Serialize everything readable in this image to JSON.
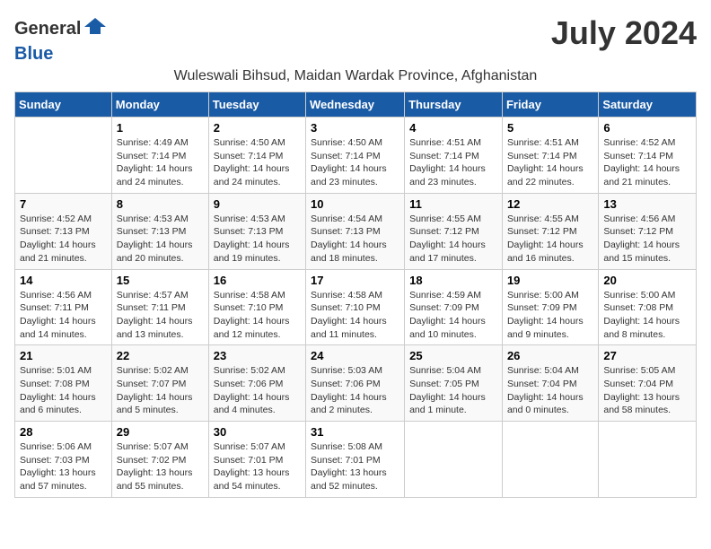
{
  "header": {
    "logo_general": "General",
    "logo_blue": "Blue",
    "month_title": "July 2024",
    "subtitle": "Wuleswali Bihsud, Maidan Wardak Province, Afghanistan"
  },
  "days_of_week": [
    "Sunday",
    "Monday",
    "Tuesday",
    "Wednesday",
    "Thursday",
    "Friday",
    "Saturday"
  ],
  "weeks": [
    [
      {
        "day": "",
        "info": ""
      },
      {
        "day": "1",
        "info": "Sunrise: 4:49 AM\nSunset: 7:14 PM\nDaylight: 14 hours\nand 24 minutes."
      },
      {
        "day": "2",
        "info": "Sunrise: 4:50 AM\nSunset: 7:14 PM\nDaylight: 14 hours\nand 24 minutes."
      },
      {
        "day": "3",
        "info": "Sunrise: 4:50 AM\nSunset: 7:14 PM\nDaylight: 14 hours\nand 23 minutes."
      },
      {
        "day": "4",
        "info": "Sunrise: 4:51 AM\nSunset: 7:14 PM\nDaylight: 14 hours\nand 23 minutes."
      },
      {
        "day": "5",
        "info": "Sunrise: 4:51 AM\nSunset: 7:14 PM\nDaylight: 14 hours\nand 22 minutes."
      },
      {
        "day": "6",
        "info": "Sunrise: 4:52 AM\nSunset: 7:14 PM\nDaylight: 14 hours\nand 21 minutes."
      }
    ],
    [
      {
        "day": "7",
        "info": "Sunrise: 4:52 AM\nSunset: 7:13 PM\nDaylight: 14 hours\nand 21 minutes."
      },
      {
        "day": "8",
        "info": "Sunrise: 4:53 AM\nSunset: 7:13 PM\nDaylight: 14 hours\nand 20 minutes."
      },
      {
        "day": "9",
        "info": "Sunrise: 4:53 AM\nSunset: 7:13 PM\nDaylight: 14 hours\nand 19 minutes."
      },
      {
        "day": "10",
        "info": "Sunrise: 4:54 AM\nSunset: 7:13 PM\nDaylight: 14 hours\nand 18 minutes."
      },
      {
        "day": "11",
        "info": "Sunrise: 4:55 AM\nSunset: 7:12 PM\nDaylight: 14 hours\nand 17 minutes."
      },
      {
        "day": "12",
        "info": "Sunrise: 4:55 AM\nSunset: 7:12 PM\nDaylight: 14 hours\nand 16 minutes."
      },
      {
        "day": "13",
        "info": "Sunrise: 4:56 AM\nSunset: 7:12 PM\nDaylight: 14 hours\nand 15 minutes."
      }
    ],
    [
      {
        "day": "14",
        "info": "Sunrise: 4:56 AM\nSunset: 7:11 PM\nDaylight: 14 hours\nand 14 minutes."
      },
      {
        "day": "15",
        "info": "Sunrise: 4:57 AM\nSunset: 7:11 PM\nDaylight: 14 hours\nand 13 minutes."
      },
      {
        "day": "16",
        "info": "Sunrise: 4:58 AM\nSunset: 7:10 PM\nDaylight: 14 hours\nand 12 minutes."
      },
      {
        "day": "17",
        "info": "Sunrise: 4:58 AM\nSunset: 7:10 PM\nDaylight: 14 hours\nand 11 minutes."
      },
      {
        "day": "18",
        "info": "Sunrise: 4:59 AM\nSunset: 7:09 PM\nDaylight: 14 hours\nand 10 minutes."
      },
      {
        "day": "19",
        "info": "Sunrise: 5:00 AM\nSunset: 7:09 PM\nDaylight: 14 hours\nand 9 minutes."
      },
      {
        "day": "20",
        "info": "Sunrise: 5:00 AM\nSunset: 7:08 PM\nDaylight: 14 hours\nand 8 minutes."
      }
    ],
    [
      {
        "day": "21",
        "info": "Sunrise: 5:01 AM\nSunset: 7:08 PM\nDaylight: 14 hours\nand 6 minutes."
      },
      {
        "day": "22",
        "info": "Sunrise: 5:02 AM\nSunset: 7:07 PM\nDaylight: 14 hours\nand 5 minutes."
      },
      {
        "day": "23",
        "info": "Sunrise: 5:02 AM\nSunset: 7:06 PM\nDaylight: 14 hours\nand 4 minutes."
      },
      {
        "day": "24",
        "info": "Sunrise: 5:03 AM\nSunset: 7:06 PM\nDaylight: 14 hours\nand 2 minutes."
      },
      {
        "day": "25",
        "info": "Sunrise: 5:04 AM\nSunset: 7:05 PM\nDaylight: 14 hours\nand 1 minute."
      },
      {
        "day": "26",
        "info": "Sunrise: 5:04 AM\nSunset: 7:04 PM\nDaylight: 14 hours\nand 0 minutes."
      },
      {
        "day": "27",
        "info": "Sunrise: 5:05 AM\nSunset: 7:04 PM\nDaylight: 13 hours\nand 58 minutes."
      }
    ],
    [
      {
        "day": "28",
        "info": "Sunrise: 5:06 AM\nSunset: 7:03 PM\nDaylight: 13 hours\nand 57 minutes."
      },
      {
        "day": "29",
        "info": "Sunrise: 5:07 AM\nSunset: 7:02 PM\nDaylight: 13 hours\nand 55 minutes."
      },
      {
        "day": "30",
        "info": "Sunrise: 5:07 AM\nSunset: 7:01 PM\nDaylight: 13 hours\nand 54 minutes."
      },
      {
        "day": "31",
        "info": "Sunrise: 5:08 AM\nSunset: 7:01 PM\nDaylight: 13 hours\nand 52 minutes."
      },
      {
        "day": "",
        "info": ""
      },
      {
        "day": "",
        "info": ""
      },
      {
        "day": "",
        "info": ""
      }
    ]
  ]
}
